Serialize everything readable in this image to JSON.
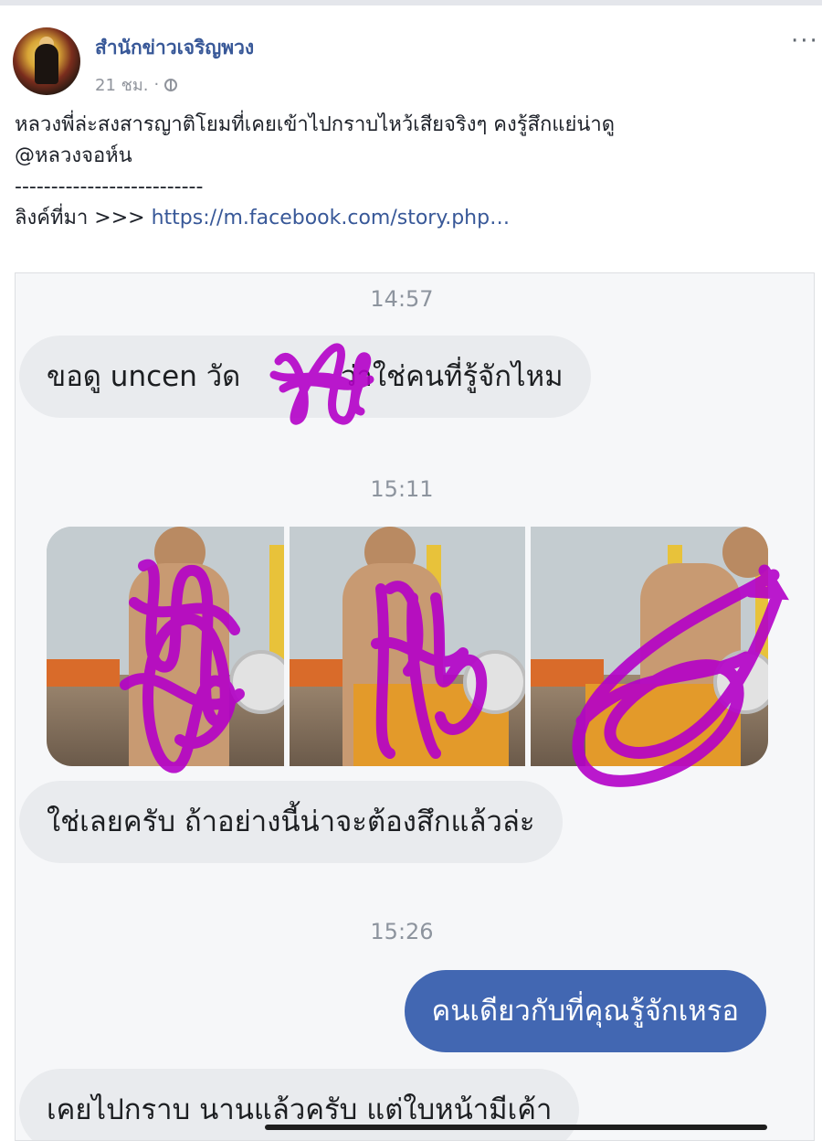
{
  "post": {
    "page_name": "สำนักข่าวเจริญพวง",
    "time": "21 ชม.",
    "separator": "·",
    "more": "···",
    "text_line1": "หลวงพี่ล่ะสงสารญาติโยมที่เคยเข้าไปกราบไหว้เสียจริงๆ คงรู้สึกแย่น่าดู",
    "text_line2": "@หลวงจอห์น",
    "divider": "--------------------------",
    "source_label": "ลิงค์ที่มา >>> ",
    "source_link": "https://m.facebook.com/story.php…"
  },
  "chat": {
    "messages": [
      {
        "time": "14:57"
      },
      {
        "direction": "incoming",
        "text_a": "ขอดู uncen วัด",
        "text_b": " ว่าใช่คนที่รู้จักไหม"
      },
      {
        "time": "15:11"
      },
      {
        "direction": "incoming",
        "text": "ใช่เลยครับ ถ้าอย่างนี้น่าจะต้องสึกแล้วล่ะ"
      },
      {
        "time": "15:26"
      },
      {
        "direction": "outgoing",
        "text": "คนเดียวกับที่คุณรู้จักเหรอ"
      },
      {
        "direction": "incoming",
        "text": "เคยไปกราบ นานแล้วครับ แต่ใบหน้ามีเค้า"
      }
    ],
    "photo_count": 3
  },
  "colors": {
    "link": "#385898",
    "outgoing_bubble": "#4267b2",
    "incoming_bubble": "#e9ebee",
    "censor_scribble": "#b400c8"
  }
}
